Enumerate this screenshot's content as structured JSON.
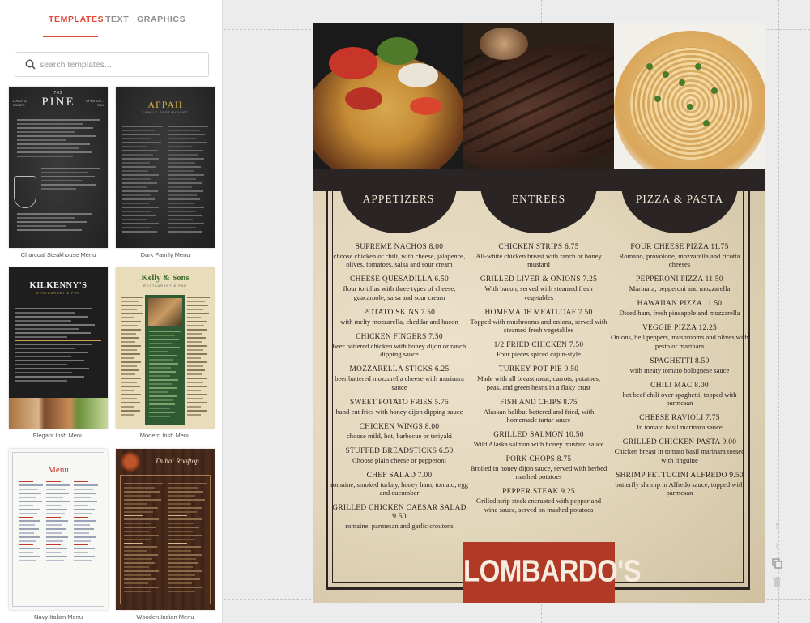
{
  "sidebar": {
    "tabs": [
      {
        "label": "TEMPLATES"
      },
      {
        "label": "TEXT"
      },
      {
        "label": "GRAPHICS"
      }
    ],
    "search": {
      "placeholder": "search templates..."
    },
    "templates": [
      {
        "label": "Charcoal Steakhouse Menu",
        "title_text": "PINE",
        "top_text": "762",
        "left_text": "LUNCH & DINNER",
        "right_text": "OPEN TUE - SUN"
      },
      {
        "label": "Dark Family Menu",
        "title_text": "APPAH",
        "sub_text": "FAMILY RESTAURANT"
      },
      {
        "label": "Elegant Irish Menu",
        "title_text": "KILKENNY'S",
        "sub_text": "RESTAURANT & PUB"
      },
      {
        "label": "Modern Irish Menu",
        "title_text": "Kelly & Sons",
        "sub_text": "RESTAURANT & PUB"
      },
      {
        "label": "Navy Italian Menu",
        "title_text": "Menu"
      },
      {
        "label": "Wooden Indian Menu",
        "title_text": "Dubai Rooftop"
      }
    ]
  },
  "menu": {
    "headings": [
      "APPETIZERS",
      "ENTREES",
      "PIZZA & PASTA"
    ],
    "columns": [
      [
        {
          "name": "SUPREME NACHOS  8.00",
          "desc": "choose chicken or chili, with cheese, jalapenos, olives, tomatoes, salsa and sour cream"
        },
        {
          "name": "CHEESE QUESADILLA  6.50",
          "desc": "flour tortillas with three types of cheese, guacamole, salsa and sour cream"
        },
        {
          "name": "POTATO SKINS  7.50",
          "desc": "with melty mozzarella, cheddar and bacon"
        },
        {
          "name": "CHICKEN FINGERS  7.50",
          "desc": "beer battered chicken with honey dijon or ranch dipping sauce"
        },
        {
          "name": "MOZZARELLA STICKS  6.25",
          "desc": "beer battered mozzarella cheese with marinara sauce"
        },
        {
          "name": "SWEET POTATO FRIES  5.75",
          "desc": "hand cut fries with honey dijon dipping sauce"
        },
        {
          "name": "CHICKEN WINGS  8.00",
          "desc": "choose mild, hot, barbecue or teriyaki"
        },
        {
          "name": "STUFFED BREADSTICKS  6.50",
          "desc": "Choose plain cheese or pepperoni"
        },
        {
          "name": "CHEF SALAD  7.00",
          "desc": "romaine, smoked turkey, honey ham, tomato, egg and cucumber"
        },
        {
          "name": "GRILLED CHICKEN CAESAR SALAD  9.50",
          "desc": "romaine, parmesan and garlic croutons"
        }
      ],
      [
        {
          "name": "CHICKEN STRIPS  6.75",
          "desc": "All-white chicken breast with ranch or honey mustard"
        },
        {
          "name": "GRILLED LIVER & ONIONS  7.25",
          "desc": "With bacon, served with steamed fresh vegetables"
        },
        {
          "name": "HOMEMADE MEATLOAF  7.50",
          "desc": "Topped with mushrooms and onions, served with steamed fresh vegetables"
        },
        {
          "name": "1/2 FRIED CHICKEN  7.50",
          "desc": "Four pieces spiced cajun-style"
        },
        {
          "name": "TURKEY POT PIE  9.50",
          "desc": "Made with all breast meat, carrots, potatoes, peas, and green beans in a flaky crust"
        },
        {
          "name": "FISH AND CHIPS  8.75",
          "desc": "Alaskan halibut battered and fried, with homemade tartar sauce"
        },
        {
          "name": "GRILLED SALMON  10.50",
          "desc": "Wild Alaska salmon with honey mustard sauce"
        },
        {
          "name": "PORK CHOPS  8.75",
          "desc": "Broiled in honey dijon sauce, served with herbed mashed potatoes"
        },
        {
          "name": "PEPPER STEAK  9.25",
          "desc": "Grilled strip steak encrusted with pepper and wine sauce, served on mashed potatoes"
        }
      ],
      [
        {
          "name": "FOUR CHEESE PIZZA  11.75",
          "desc": "Romano, provolone, mozzarella and ricotta cheeses"
        },
        {
          "name": "PEPPERONI PIZZA  11.50",
          "desc": "Marinara, pepperoni and mozzarella"
        },
        {
          "name": "HAWAIIAN PIZZA  11.50",
          "desc": "Diced ham, fresh pineapple and mozzarella"
        },
        {
          "name": "VEGGIE PIZZA  12.25",
          "desc": "Onions, bell peppers, mushrooms and olives with pesto or marinara"
        },
        {
          "name": "SPAGHETTI  8.50",
          "desc": "with meaty tomato bolognese sauce"
        },
        {
          "name": "CHILI MAC  8.00",
          "desc": "hot beef chili over spaghetti, topped with parmesan"
        },
        {
          "name": "CHEESE RAVIOLI  7.75",
          "desc": "In tomato basil marinara sauce"
        },
        {
          "name": "GRILLED CHICKEN PASTA  9.00",
          "desc": "Chicken breast in tomato basil marinara tossed with linguine"
        },
        {
          "name": "SHRIMP FETTUCINI ALFREDO  9.50",
          "desc": "butterfly shrimp in Alfredo sauce, topped with parmesan"
        }
      ]
    ],
    "logo": "LOMBARDO'S"
  },
  "colors": {
    "accent": "#e2483b",
    "menu_dark": "#2b2424",
    "logo_red": "#b03a26"
  },
  "icons": [
    "search-icon",
    "arrow-up-icon",
    "arrow-down-icon",
    "duplicate-icon",
    "trash-icon"
  ]
}
